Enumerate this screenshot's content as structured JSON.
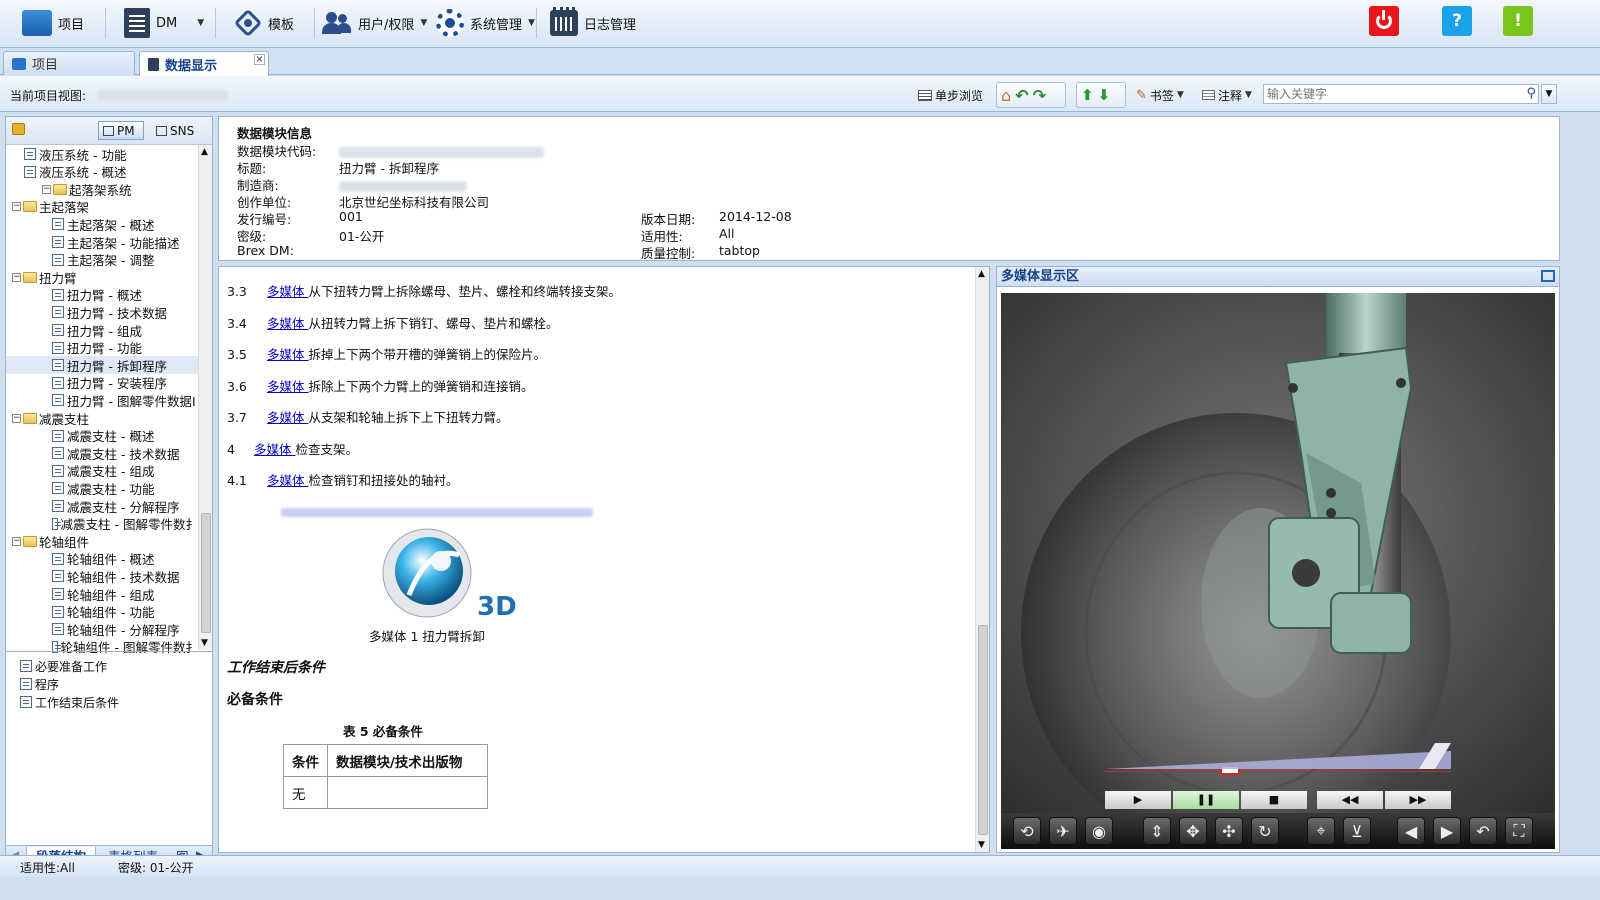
{
  "toolbar": {
    "project": "项目",
    "dm": "DM",
    "template": "模板",
    "user_perm": "用户/权限",
    "sys_mgmt": "系统管理",
    "log_mgmt": "日志管理",
    "help": "?",
    "alert": "!"
  },
  "tabs": [
    {
      "label": "项目"
    },
    {
      "label": "数据显示"
    }
  ],
  "viewbar": {
    "current_view_label": "当前项目视图:",
    "single_step": "单步浏览",
    "bookmark": "书签",
    "annotation": "注释",
    "search_placeholder": "输入关键字"
  },
  "left_panel": {
    "pm": "PM",
    "sns": "SNS",
    "tree": [
      {
        "label": "液压系统 - 功能",
        "type": "leaf",
        "depth": 2
      },
      {
        "label": "液压系统 - 概述",
        "type": "leaf",
        "depth": 2
      },
      {
        "label": "起落架系统",
        "type": "folder",
        "depth": 0
      },
      {
        "label": "主起落架",
        "type": "folder",
        "depth": 1
      },
      {
        "label": "主起落架 - 概述",
        "type": "leaf",
        "depth": 3
      },
      {
        "label": "主起落架 - 功能描述",
        "type": "leaf",
        "depth": 3
      },
      {
        "label": "主起落架 - 调整",
        "type": "leaf",
        "depth": 3
      },
      {
        "label": "扭力臂",
        "type": "folder",
        "depth": 1
      },
      {
        "label": "扭力臂 - 概述",
        "type": "leaf",
        "depth": 3
      },
      {
        "label": "扭力臂 - 技术数据",
        "type": "leaf",
        "depth": 3
      },
      {
        "label": "扭力臂 - 组成",
        "type": "leaf",
        "depth": 3
      },
      {
        "label": "扭力臂 - 功能",
        "type": "leaf",
        "depth": 3
      },
      {
        "label": "扭力臂 - 拆卸程序",
        "type": "leaf",
        "depth": 3,
        "selected": true
      },
      {
        "label": "扭力臂 - 安装程序",
        "type": "leaf",
        "depth": 3
      },
      {
        "label": "扭力臂 - 图解零件数据I",
        "type": "leaf",
        "depth": 3
      },
      {
        "label": "减震支柱",
        "type": "folder",
        "depth": 1
      },
      {
        "label": "减震支柱 - 概述",
        "type": "leaf",
        "depth": 3
      },
      {
        "label": "减震支柱 - 技术数据",
        "type": "leaf",
        "depth": 3
      },
      {
        "label": "减震支柱 - 组成",
        "type": "leaf",
        "depth": 3
      },
      {
        "label": "减震支柱 - 功能",
        "type": "leaf",
        "depth": 3
      },
      {
        "label": "减震支柱 - 分解程序",
        "type": "leaf",
        "depth": 3
      },
      {
        "label": "减震支柱 - 图解零件数扌",
        "type": "leaf",
        "depth": 3
      },
      {
        "label": "轮轴组件",
        "type": "folder",
        "depth": 1
      },
      {
        "label": "轮轴组件 - 概述",
        "type": "leaf",
        "depth": 3
      },
      {
        "label": "轮轴组件 - 技术数据",
        "type": "leaf",
        "depth": 3
      },
      {
        "label": "轮轴组件 - 组成",
        "type": "leaf",
        "depth": 3
      },
      {
        "label": "轮轴组件 - 功能",
        "type": "leaf",
        "depth": 3
      },
      {
        "label": "轮轴组件 - 分解程序",
        "type": "leaf",
        "depth": 3
      },
      {
        "label": "轮轴组件 - 图解零件数扌",
        "type": "leaf",
        "depth": 3
      }
    ],
    "outline": [
      "必要准备工作",
      "程序",
      "工作结束后条件"
    ],
    "bottom_tabs": [
      "段落结构",
      "表格列表",
      "图"
    ]
  },
  "info": {
    "heading": "数据模块信息",
    "dm_code_label": "数据模块代码:",
    "title_label": "标题:",
    "title_value": "扭力臂 - 拆卸程序",
    "mfr_label": "制造商:",
    "author_label": "创作单位:",
    "author_value": "北京世纪坐标科技有限公司",
    "issue_label": "发行编号:",
    "issue_value": "001",
    "date_label": "版本日期:",
    "date_value": "2014-12-08",
    "security_label": "密级:",
    "security_value": "01-公开",
    "applic_label": "适用性:",
    "applic_value": "All",
    "brex_label": "Brex DM:",
    "qa_label": "质量控制:",
    "qa_value": "tabtop"
  },
  "content": {
    "steps": [
      {
        "num": "3.3",
        "link": "多媒体 ",
        "text": "从下扭转力臂上拆除螺母、垫片、螺栓和终端转接支架。"
      },
      {
        "num": "3.4",
        "link": "多媒体 ",
        "text": "从扭转力臂上拆下销钉、螺母、垫片和螺栓。"
      },
      {
        "num": "3.5",
        "link": "多媒体 ",
        "text": "拆掉上下两个带开槽的弹簧销上的保险片。"
      },
      {
        "num": "3.6",
        "link": "多媒体 ",
        "text": "拆除上下两个力臂上的弹簧销和连接销。"
      },
      {
        "num": "3.7",
        "link": "多媒体 ",
        "text": "从支架和轮轴上拆下上下扭转力臂。"
      },
      {
        "num": "4",
        "link": "多媒体 ",
        "text": "检查支架。"
      },
      {
        "num": "4.1",
        "link": "多媒体 ",
        "text": "检查销钉和扭接处的轴衬。"
      }
    ],
    "figure_caption": "多媒体 1 扭力臂拆卸",
    "logo_text": "3D",
    "closeout_heading": "工作结束后条件",
    "required_heading": "必备条件",
    "table_title": "表 5 必备条件",
    "table_headers": [
      "条件",
      "数据模块/技术出版物"
    ],
    "table_rows": [
      [
        "无",
        ""
      ]
    ]
  },
  "media": {
    "title": "多媒体显示区",
    "progress": 0.36
  },
  "status": {
    "applicability": "适用性:All",
    "security": "密级: 01-公开"
  },
  "colors": {
    "accent": "#15428b",
    "power": "#e8151b",
    "help": "#1aa3e8",
    "alert": "#7ac41c",
    "link": "#0000cc"
  }
}
